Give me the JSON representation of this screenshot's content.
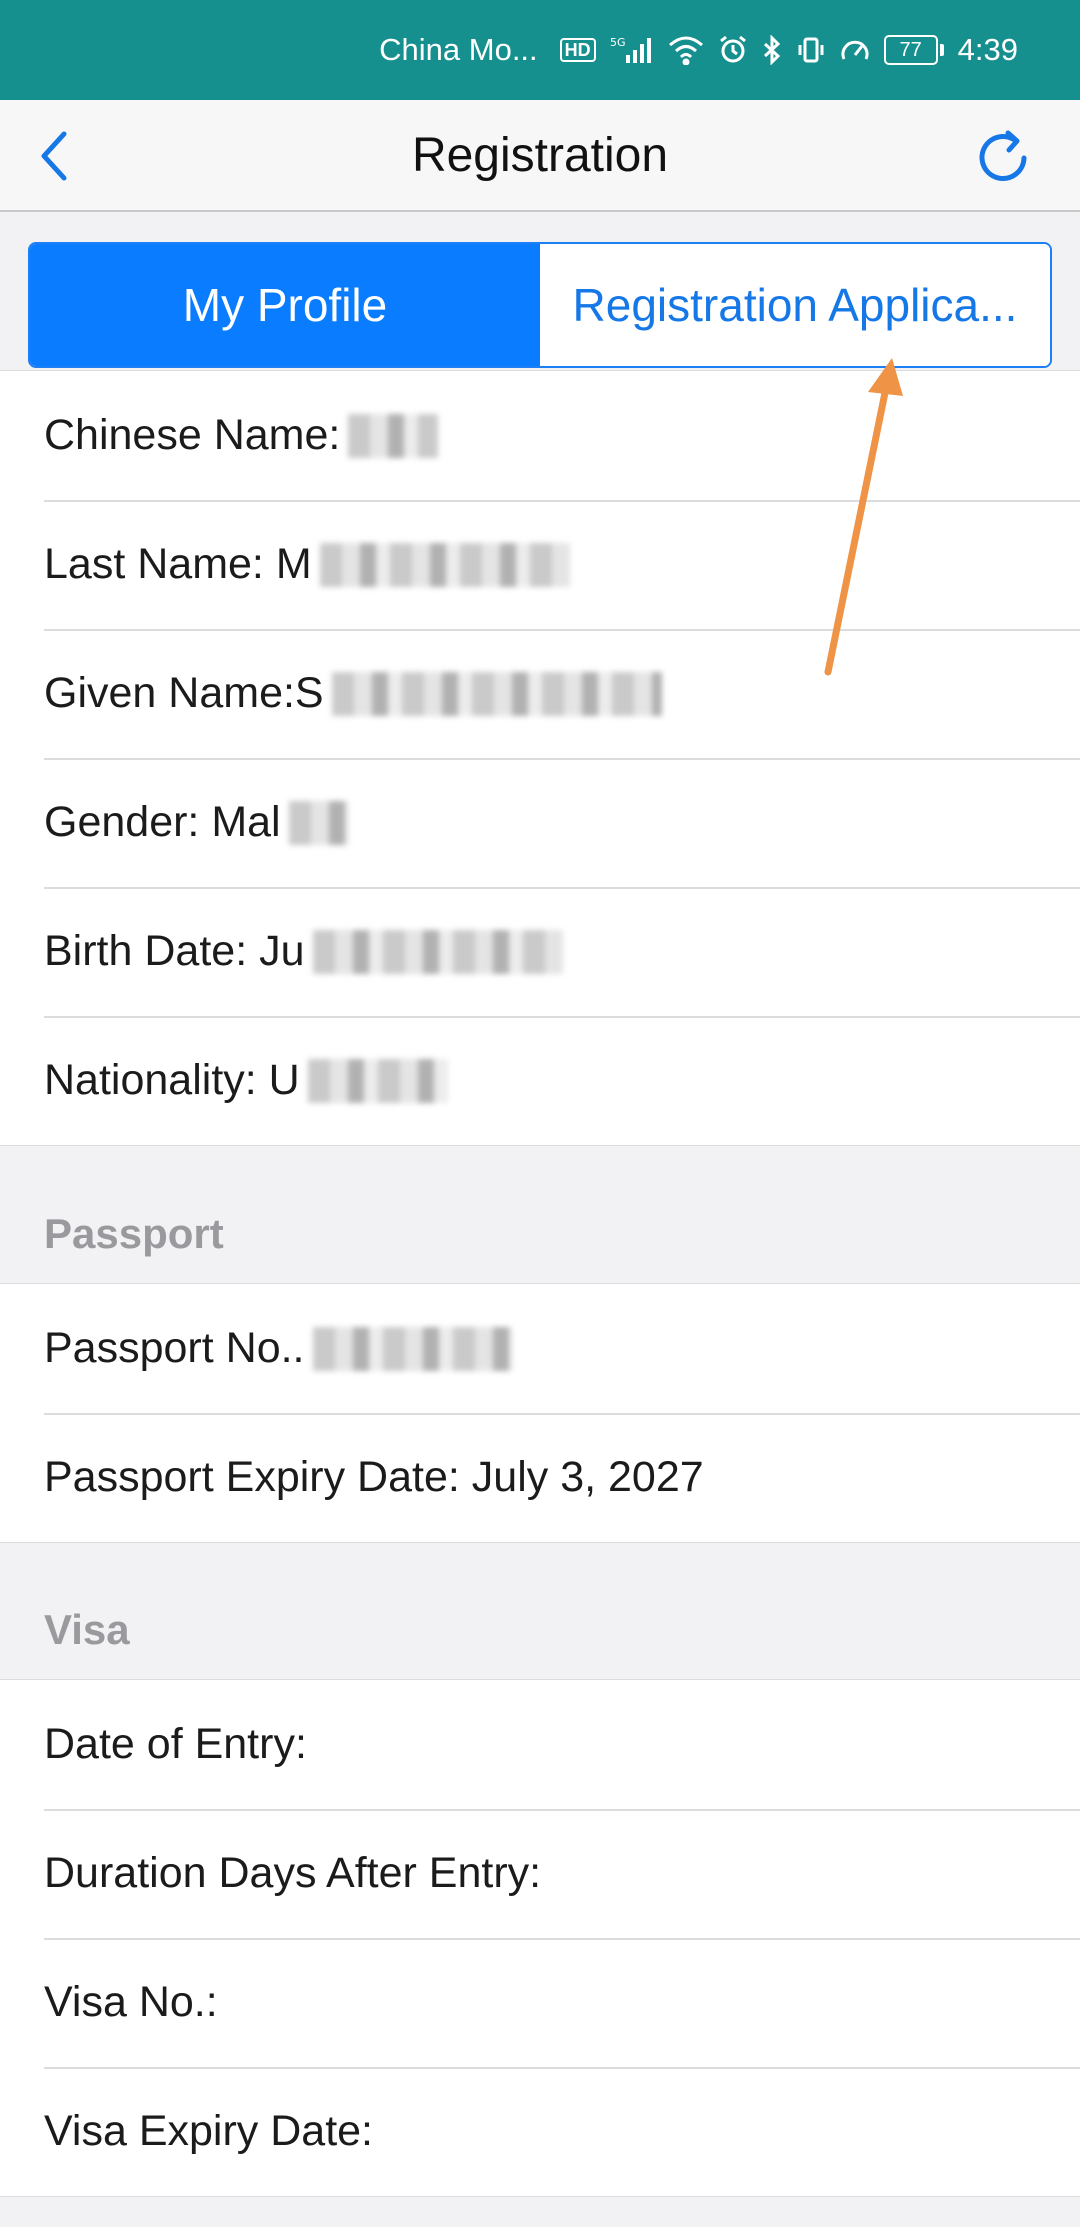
{
  "status_bar": {
    "carrier": "China Mo...",
    "hd": "HD",
    "network": "5G",
    "battery": "77",
    "time": "4:39"
  },
  "nav": {
    "title": "Registration",
    "back_icon": "chevron-left-icon",
    "refresh_icon": "refresh-icon",
    "accent_color": "#1677e6"
  },
  "tabs": [
    {
      "label": "My Profile",
      "active": true
    },
    {
      "label": "Registration Applica...",
      "active": false
    }
  ],
  "profile": {
    "chinese_name_label": "Chinese Name:",
    "last_name_label": "Last Name: M",
    "given_name_label": "Given Name:S",
    "gender_label": "Gender: Mal",
    "birth_date_label": "Birth Date: Ju",
    "nationality_label": "Nationality: U"
  },
  "passport": {
    "section_title": "Passport",
    "number_label": "Passport No..",
    "expiry_label": "Passport Expiry Date: July 3, 2027"
  },
  "visa": {
    "section_title": "Visa",
    "date_of_entry_label": "Date of Entry:",
    "duration_label": "Duration Days After Entry:",
    "visa_no_label": "Visa No.:",
    "visa_expiry_label": "Visa Expiry Date:"
  },
  "colors": {
    "status_bar": "#16908f",
    "segment_active": "#0a7cff",
    "annotation_arrow": "#ef9446"
  }
}
